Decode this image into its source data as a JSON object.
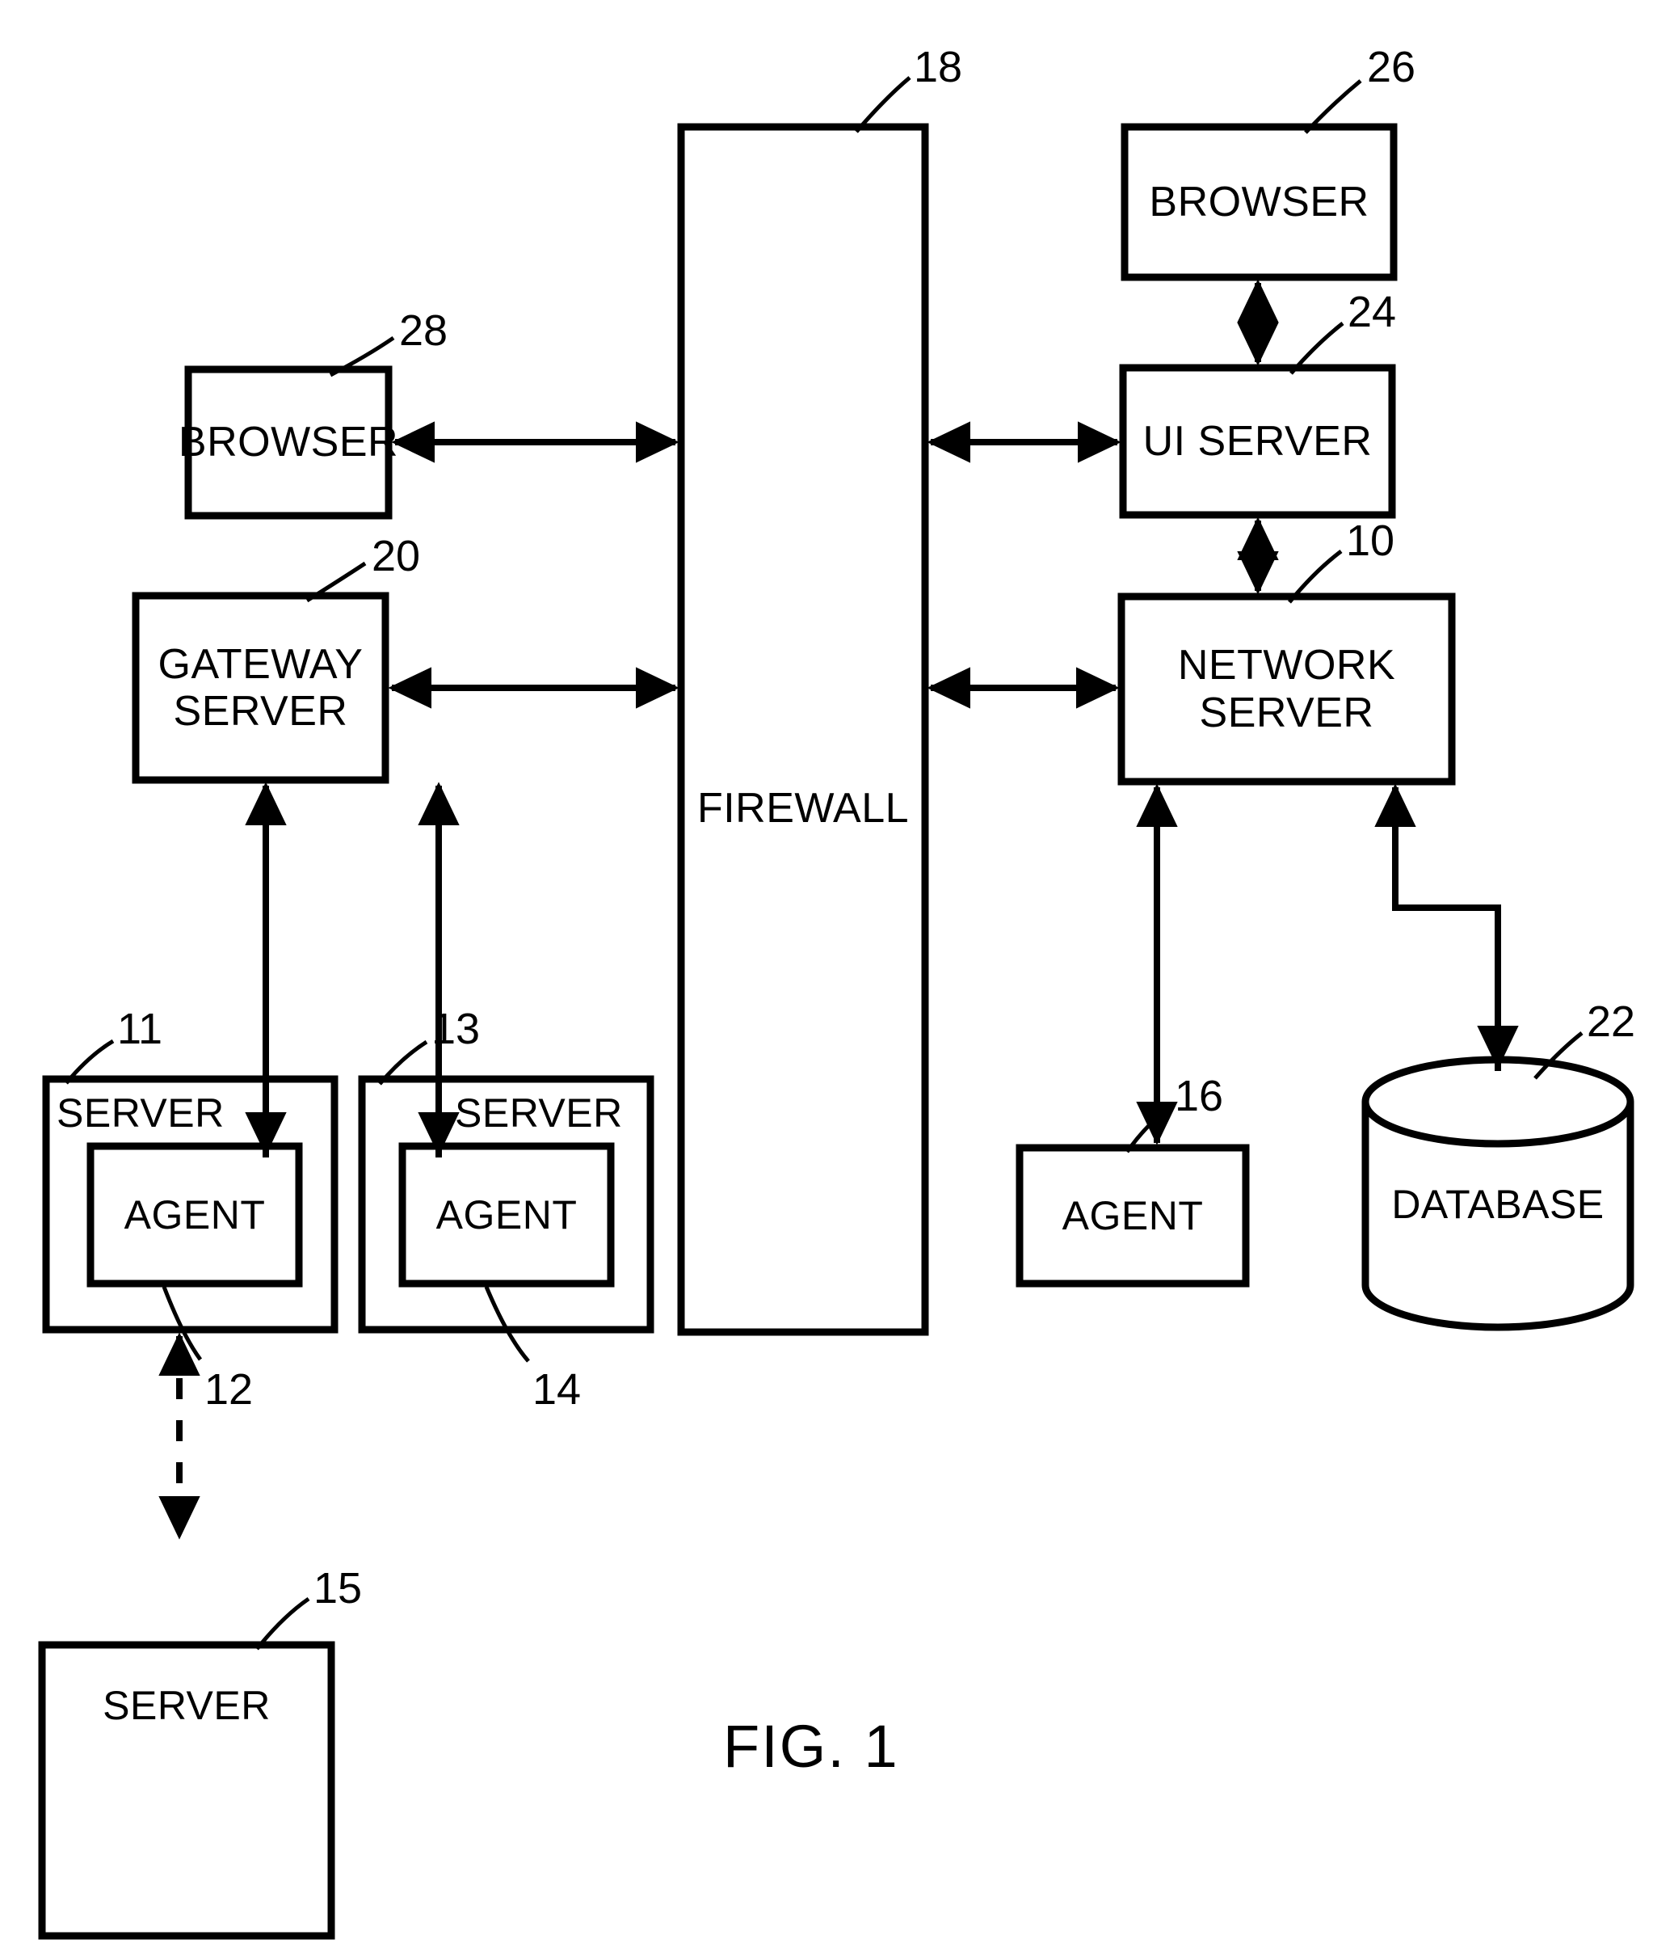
{
  "figure": {
    "caption": "FIG. 1",
    "type": "patent-block-diagram"
  },
  "nodes": {
    "browser_left": {
      "label": "BROWSER",
      "ref": "28"
    },
    "gateway_server": {
      "label": "GATEWAY\nSERVER",
      "ref": "20"
    },
    "firewall": {
      "label": "FIREWALL",
      "ref": "18"
    },
    "browser_right": {
      "label": "BROWSER",
      "ref": "26"
    },
    "ui_server": {
      "label": "UI SERVER",
      "ref": "24"
    },
    "network_server": {
      "label": "NETWORK\nSERVER",
      "ref": "10"
    },
    "server_11": {
      "label": "SERVER",
      "ref": "11"
    },
    "agent_12": {
      "label": "AGENT",
      "ref": "12"
    },
    "server_13": {
      "label": "SERVER",
      "ref": "13"
    },
    "agent_14": {
      "label": "AGENT",
      "ref": "14"
    },
    "server_15": {
      "label": "SERVER",
      "ref": "15"
    },
    "agent_16": {
      "label": "AGENT",
      "ref": "16"
    },
    "database_22": {
      "label": "DATABASE",
      "ref": "22"
    }
  },
  "colors": {
    "stroke": "#000000",
    "background": "#ffffff"
  }
}
